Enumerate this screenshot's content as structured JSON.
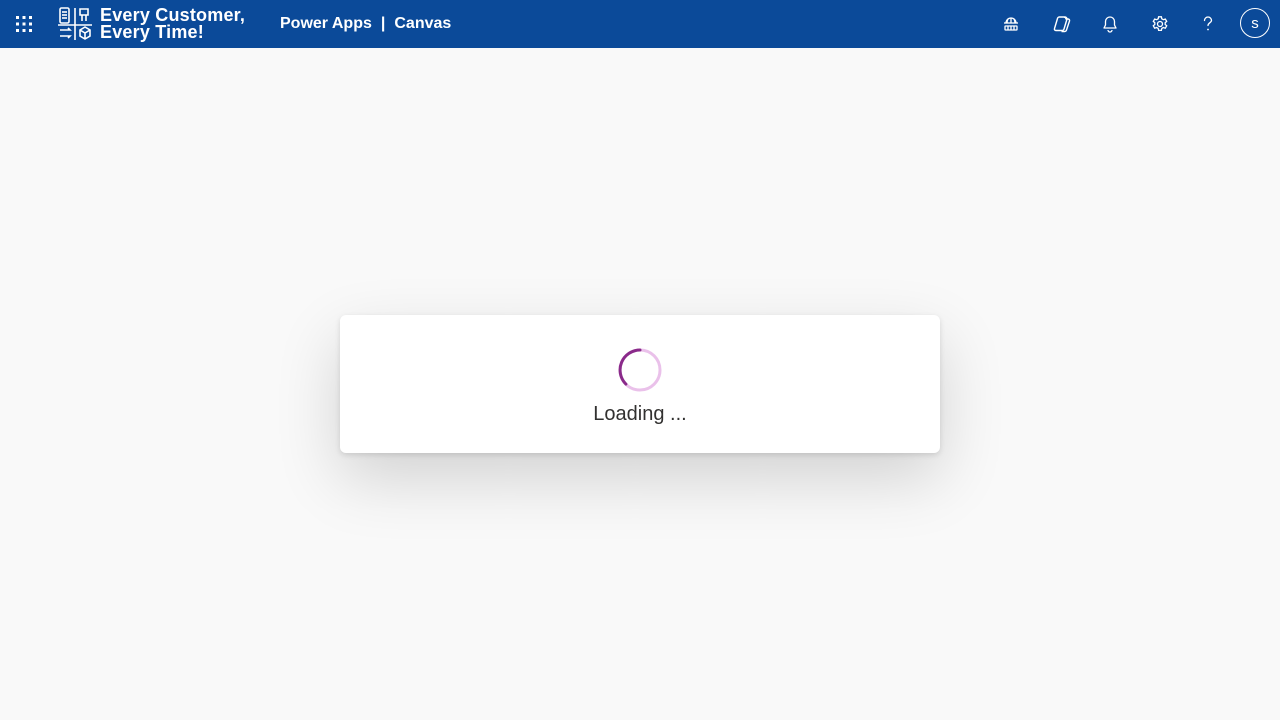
{
  "header": {
    "brand_line1": "Every Customer,",
    "brand_line2": "Every Time!",
    "app_name": "Power Apps",
    "separator": "|",
    "environment": "Canvas",
    "icons": [
      "waffle-icon",
      "environment-icon",
      "copilot-icon",
      "bell-icon",
      "gear-icon",
      "help-icon"
    ],
    "avatar_initial": "s",
    "bar_color": "#0b4a99"
  },
  "dialog": {
    "loading_text": "Loading ...",
    "spinner_track_color": "#eac1ea",
    "spinner_arc_color": "#8a2a8a"
  }
}
